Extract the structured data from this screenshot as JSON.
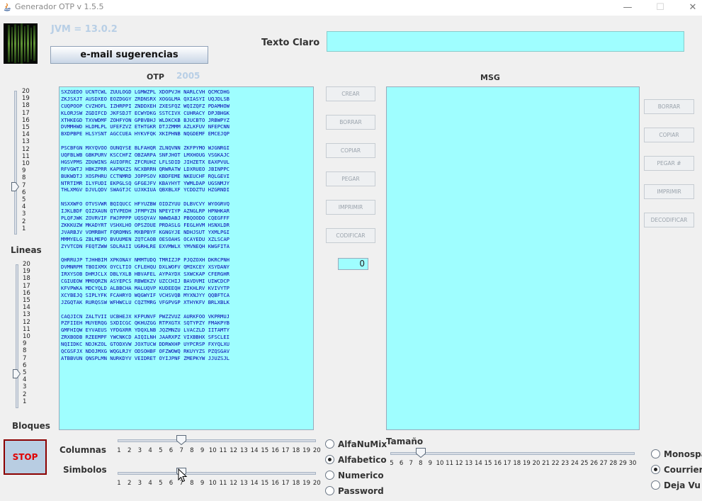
{
  "window": {
    "title": "Generador OTP v 1.5.5",
    "minimize_glyph": "—",
    "maximize_glyph": "☐",
    "close_glyph": "✕"
  },
  "header": {
    "jvm": "JVM = 13.0.2",
    "email_button": "e-mail  sugerencias",
    "texto_claro_label": "Texto Claro",
    "texto_claro_value": ""
  },
  "otp": {
    "label": "OTP",
    "year": "2005",
    "lines": [
      "SXZGEDO UCNTCWL ZUULOGD LGMWZPL XDOPVJH NARLCVH QCMCDHG",
      "ZKJSXJT AUSDXEO EOZDGGY ZRDNSRX XOGGLMA QXIASYI UQJDLSB",
      "CUQPOOP CVZHOFL IZHRPPI ZNDDXEH ZXESFQZ WQIZQFZ PDAMHOW",
      "KLORJSW ZGDIFCD JKFSDJT ECWYDKG SSTCIVX CUHRACY DPJBHGK",
      "XTHKEGD TXVWDMF ZOHFYON GPBVBHJ WLDKCKB BJUCBTO JRBWPYZ",
      "DVMMHWD HLDMLPL UFEFZVZ ETHTGKR DTJZMMM AZLKFUV NFEPCNN",
      "BXDPBPE HLSYSNT AGCCUEA HYKVFQK XKIPHNB NQGDEMF EMCEJQP",
      "",
      "PSCBFGN MXYQVOO OUNQYSE BLFAHQR ZLNQVNN ZKFPYMO WJGNRGI",
      "UQFBLWB GBKPURV KSCCHFZ OBZARPA SNFJHOT LMXHOUG VSGKAJC",
      "HGSVPMS ZDUWINS AUIOFRC ZFCRUHZ LFLSDID JIHZETX EAXPVUL",
      "RFVGWTJ HBKZPRR KAPNXZS NCXBRRN QRWRATW LDXRUEO JBINPPC",
      "BUKWDTJ XOSPHRU CCTNMRD JOPPSOV KBDFEME NKEUCHF RQLGEVI",
      "NTRTIMR ILYFUDI EKPGLSQ GFGEJFV KBAYHYT YWMLDAP UGSNMJY",
      "THLXMGV DJVLQDV SWAGTJC UJXKIUA QBXBLXF YCDDZTU HZGRNDI",
      "",
      "NSXXWFO OTVSVWR BQIQUCC HFYUZBW OIDZYUU DLBVCVY WYOGRVQ",
      "IJKLBDF QIZXAUN QTVPEDH JFMPYZN NPEYIYP AZNGLRP HPNHKAR",
      "PLQFJWK ZOVRVIF FWJPPPP UQSQYAV NWWDABJ PBQOODO CQEGFFF",
      "ZKKKUZW MKADYRT VSHXLHO OPSZOUE PRDASLG FEGLHVM HSNXLDR",
      "JVARBJV VOMRBHT FQRDMNS MXBPBYF KGNGYJE NDHJSUT YXMLPGI",
      "MMMYELG ZBLMEPO BVUUMEN ZQTCAOB OESOAHS OCAYEDU XZLSCAP",
      "ZYVTCDN FEQTZWW SDLRAII UGRHLRE EXVMWLX YMVNEQH KWGFITA",
      "",
      "QHRRUJP TJHHBIM XPKONAY NMMTUDQ TMRIZJP PJQZOXH DKRCPNH",
      "DVMNRPM TBOIXMX OYCLTIO CFLEHQU DXLWOFV QMIKCEY XSYDANY",
      "IRXYSOB DHMJCLX DBLYXLB HBVAFEL AYPAYDX SXWCKAP CFERGHR",
      "CGIUEOW MMOQRZN ASYEPCS RBWEKZV UZCCHIJ BAVDVMI UIWCDCP",
      "KFVPWKA MDCYQLD ALBBCHA MALUQVP KUDEEQH ZIKHLRV KVIVYTP",
      "XCYBEJQ SIPLYFK FCAHRYO WQGWYIF VCHSVQB MYXNJYY QQBFTCA",
      "JZGQTAK RURQSSW WFHWCLU CQZTMRG VFGPVGP XTHYKFV BRLXBLK",
      "",
      "CAQJICN ZALTVII UCBHEJX KFPUNVF PWZZVUZ AURKFOO VKPRMUJ",
      "PZFIIEH MUYERQG SXDICGC QKHUZGG RTPXGTX SQTYPZY FMAKPYB",
      "GMFHIQW EYVAEUS YFDGXRR YDQXLNB JQZMNZU LVACZLD IITAMTY",
      "ZRXBODB RZEEMPF YWCNKCD AIQILNH JAARXPZ VIXBBHX SFSCLEI",
      "NQIIDKC NDJKZOL GTODXVW JOXTUCW DDRWXHP UYPCRSP FXYQLXU",
      "QCGSFJX NDOJMXG WQGLRJY ODSOHBF OFZWOWQ RKUYYZS PZQSGAV",
      "ATBBVUN QNSPLMN NURKDYV VEIDRET OYIJPNF ZMEPKYW JJUZSJL"
    ]
  },
  "msg": {
    "label": "MSG",
    "content": ""
  },
  "left_buttons": {
    "crear": "CREAR",
    "borrar": "BORRAR",
    "copiar": "COPIAR",
    "pegar": "PEGAR",
    "imprimir": "IMPRIMIR",
    "codificar": "CODIFICAR"
  },
  "right_buttons": {
    "borrar": "BORRAR",
    "copiar": "COPIAR",
    "pegar": "PEGAR #",
    "imprimir": "IMPRIMIR",
    "decodificar": "DECODIFICAR"
  },
  "counter": "0",
  "lineas_slider": {
    "label": "Lineas",
    "min": 1,
    "max": 20,
    "value": 7,
    "ticks": [
      "20",
      "19",
      "18",
      "17",
      "16",
      "15",
      "14",
      "13",
      "12",
      "11",
      "10",
      "9",
      "8",
      "7",
      "6",
      "5",
      "4",
      "3",
      "2",
      "1"
    ]
  },
  "bloques_slider": {
    "label": "Bloques",
    "min": 1,
    "max": 20,
    "value": 5,
    "ticks": [
      "20",
      "19",
      "18",
      "17",
      "16",
      "15",
      "14",
      "13",
      "12",
      "11",
      "10",
      "9",
      "8",
      "7",
      "6",
      "5",
      "4",
      "3",
      "2",
      "1"
    ]
  },
  "columnas_slider": {
    "label": "Columnas",
    "min": 1,
    "max": 20,
    "value": 7,
    "ticks": [
      "1",
      "2",
      "3",
      "4",
      "5",
      "6",
      "7",
      "8",
      "9",
      "10",
      "11",
      "12",
      "13",
      "14",
      "15",
      "16",
      "17",
      "18",
      "19",
      "20"
    ]
  },
  "simbolos_slider": {
    "label": "Simbolos",
    "min": 1,
    "max": 20,
    "value": 7,
    "ticks": [
      "1",
      "2",
      "3",
      "4",
      "5",
      "6",
      "7",
      "8",
      "9",
      "10",
      "11",
      "12",
      "13",
      "14",
      "15",
      "16",
      "17",
      "18",
      "19",
      "20"
    ]
  },
  "tamano_slider": {
    "label": "Tamaño",
    "min": 5,
    "max": 30,
    "value": 8,
    "ticks": [
      "5",
      "6",
      "7",
      "8",
      "9",
      "10",
      "11",
      "12",
      "13",
      "14",
      "15",
      "16",
      "17",
      "18",
      "19",
      "20",
      "21",
      "22",
      "23",
      "24",
      "25",
      "26",
      "27",
      "28",
      "29",
      "30"
    ]
  },
  "stop_button": "STOP",
  "charset_options": [
    {
      "label": "AlfaNuMix",
      "selected": false
    },
    {
      "label": "Alfabetico",
      "selected": true
    },
    {
      "label": "Numerico",
      "selected": false
    },
    {
      "label": "Password",
      "selected": false
    }
  ],
  "font_options": [
    {
      "label": "Monospaced",
      "selected": false
    },
    {
      "label": "Courrier",
      "selected": true
    },
    {
      "label": "Deja Vu",
      "selected": false
    }
  ],
  "colors": {
    "textarea_bg": "#9ffeff",
    "otp_text": "#0000b0",
    "stop_text": "#e00000",
    "stop_border": "#8b0000",
    "accent_label": "#b8cfe6"
  }
}
